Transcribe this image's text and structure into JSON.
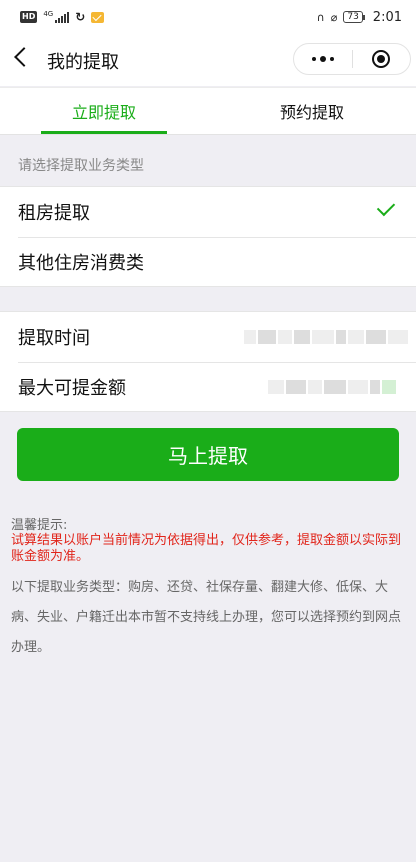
{
  "status_bar": {
    "hd": "HD",
    "network": "4G",
    "battery": "73",
    "time": "2:01"
  },
  "nav": {
    "title": "我的提取"
  },
  "tabs": [
    {
      "label": "立即提取",
      "active": true
    },
    {
      "label": "预约提取",
      "active": false
    }
  ],
  "section_hint": "请选择提取业务类型",
  "business_types": [
    {
      "label": "租房提取",
      "selected": true
    },
    {
      "label": "其他住房消费类",
      "selected": false
    }
  ],
  "info": {
    "time_label": "提取时间",
    "amount_label": "最大可提金额"
  },
  "submit_label": "马上提取",
  "tips": {
    "title": "温馨提示:",
    "warning": "试算结果以账户当前情况为依据得出，仅供参考，提取金额以实际到账金额为准。",
    "body": "以下提取业务类型：购房、还贷、社保存量、翻建大修、低保、大病、失业、户籍迁出本市暂不支持线上办理，您可以选择预约到网点办理。"
  },
  "colors": {
    "accent": "#1aad19",
    "warning": "#e1251b",
    "background": "#efeef3"
  },
  "icons": [
    "back-arrow-icon",
    "more-dots-icon",
    "close-target-icon",
    "check-icon"
  ]
}
